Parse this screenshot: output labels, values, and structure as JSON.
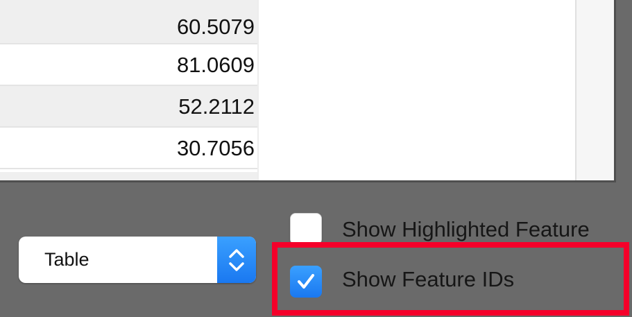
{
  "table": {
    "values": [
      "60.5079",
      "81.0609",
      "52.2112",
      "30.7056"
    ]
  },
  "view_select": {
    "value": "Table"
  },
  "options": {
    "show_highlighted_label": "Show Highlighted Feature",
    "show_highlighted_checked": false,
    "show_ids_label": "Show Feature IDs",
    "show_ids_checked": true
  },
  "colors": {
    "accent": "#1a78f0",
    "highlight_outline": "#f5002a",
    "panel_bg": "#6a6a6a"
  }
}
